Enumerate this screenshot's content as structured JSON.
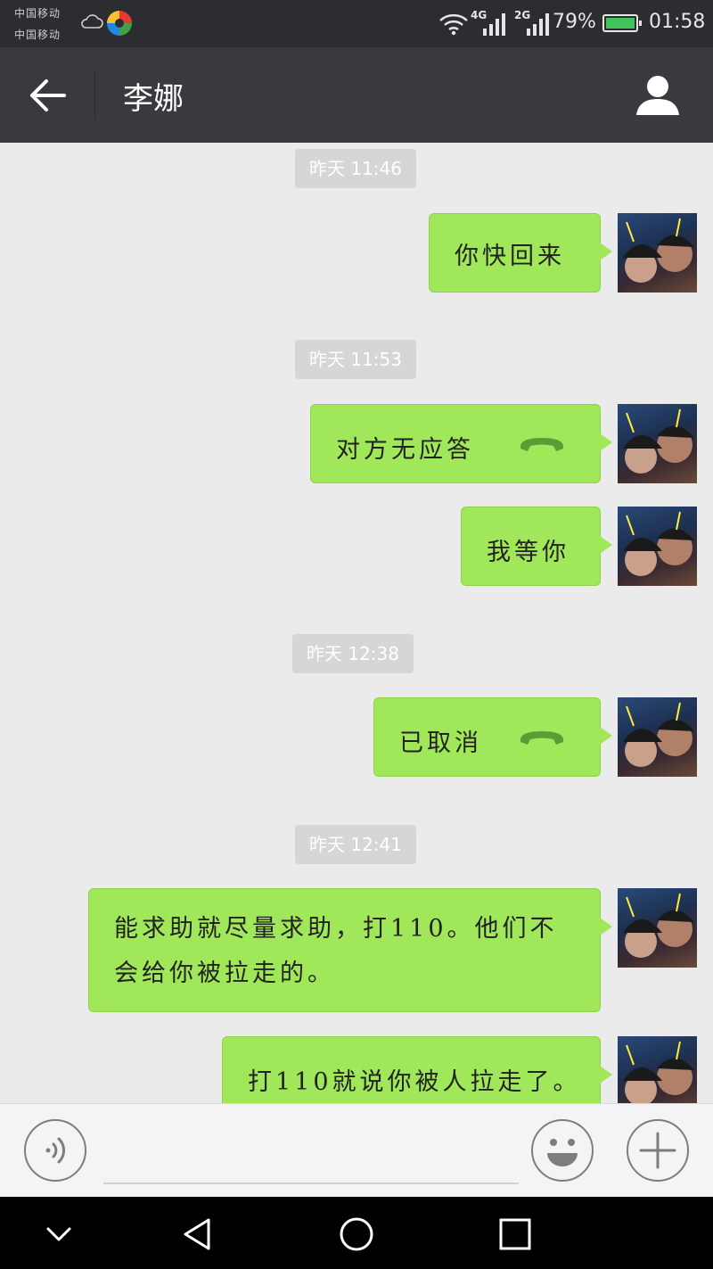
{
  "statusbar": {
    "carrier1": "中国移动",
    "carrier2": "中国移动",
    "net1": "4G",
    "net2": "2G",
    "battery_pct": "79%",
    "time": "01:58",
    "icons": [
      "cloud-icon",
      "app-icon",
      "wifi-icon",
      "signal-icon",
      "battery-icon"
    ]
  },
  "header": {
    "title": "李娜",
    "icons": [
      "back-arrow-icon",
      "contact-icon"
    ]
  },
  "chat": {
    "timestamps": [
      "昨天 11:46",
      "昨天 11:53",
      "昨天 12:38",
      "昨天 12:41"
    ],
    "messages": [
      {
        "text": "你快回来",
        "type": "text"
      },
      {
        "text": "对方无应答",
        "type": "call"
      },
      {
        "text": "我等你",
        "type": "text"
      },
      {
        "text": "已取消",
        "type": "call"
      },
      {
        "text": "能求助就尽量求助，打110。他们不会给你被拉走的。",
        "line1": "能求助就尽量求助，打110。他们不",
        "line2": "会给你被拉走的。",
        "type": "text"
      },
      {
        "text": "打110就说你被人拉走了。",
        "type": "text"
      }
    ]
  },
  "inputbar": {
    "placeholder": "",
    "icons": [
      "voice-icon",
      "emoji-icon",
      "plus-icon"
    ]
  },
  "navbar": {
    "icons": [
      "hide-keyboard-icon",
      "back-icon",
      "home-icon",
      "recents-icon"
    ]
  },
  "colors": {
    "bubble": "#a0e75a",
    "header": "#393a3f",
    "chat_bg": "#ebebeb",
    "timestamp_bg": "#d6d6d6"
  }
}
